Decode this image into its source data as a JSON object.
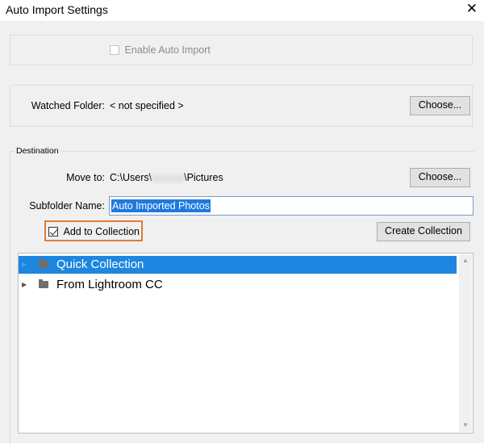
{
  "window": {
    "title": "Auto Import Settings",
    "close_icon": "✕"
  },
  "enable": {
    "label": "Enable Auto Import",
    "checked": false,
    "disabled": true
  },
  "watched": {
    "label": "Watched Folder:",
    "value": "< not specified >",
    "choose_label": "Choose..."
  },
  "destination": {
    "legend": "Destination",
    "move_to_label": "Move to:",
    "path_prefix": "C:\\Users\\",
    "path_suffix": "\\Pictures",
    "choose_label": "Choose...",
    "subfolder_label": "Subfolder Name:",
    "subfolder_value": "Auto Imported Photos",
    "add_to_collection_label": "Add to Collection",
    "add_to_collection_checked": true,
    "create_collection_label": "Create Collection"
  },
  "collections": [
    {
      "name": "Quick Collection",
      "selected": true
    },
    {
      "name": "From Lightroom CC",
      "selected": false
    }
  ],
  "colors": {
    "accent": "#1e86e0",
    "highlight_border": "#e4793a",
    "selection_text": "#1f7ae0"
  }
}
